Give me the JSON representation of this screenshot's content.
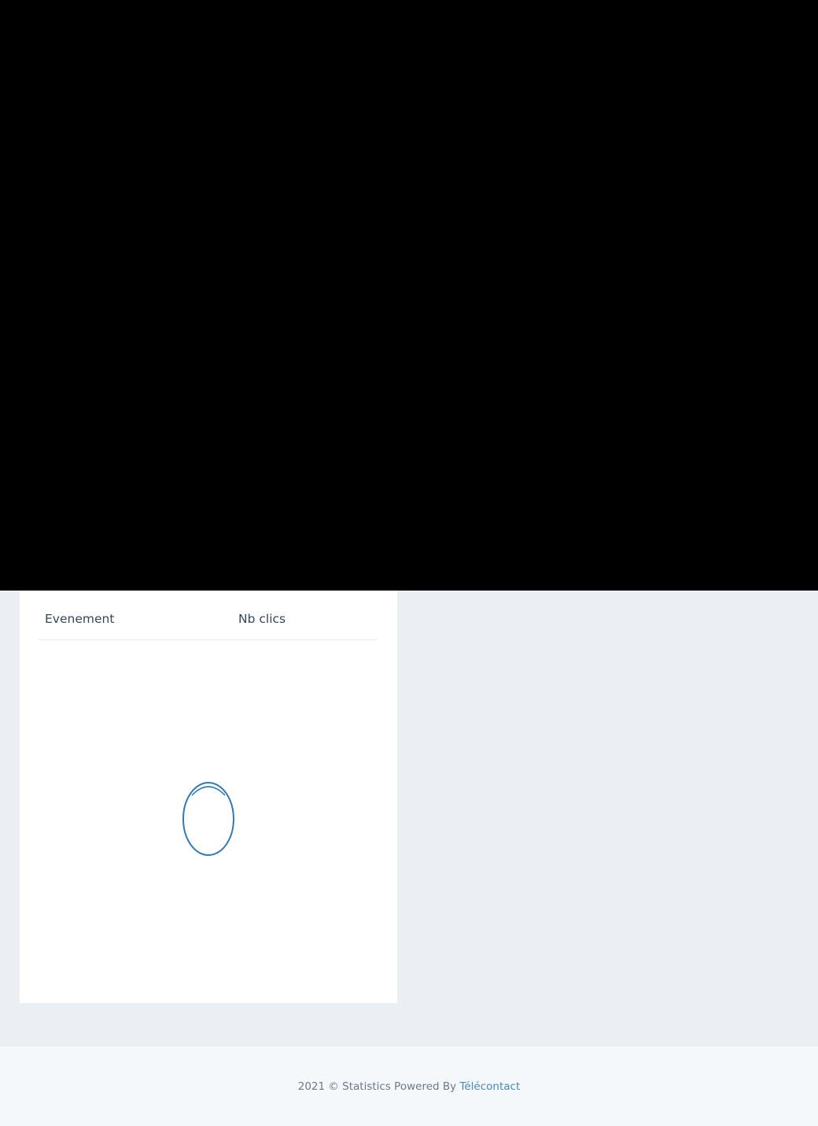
{
  "table": {
    "columns": [
      "Evenement",
      "Nb clics"
    ],
    "rows": []
  },
  "loading": {
    "icon": "loading-spinner-icon",
    "color": "#2f7bb5"
  },
  "footer": {
    "text": "2021 © Statistics Powered By",
    "link_label": "Télécontact"
  },
  "colors": {
    "page_background": "#ebeef2",
    "overlay": "#000000",
    "card_background": "#ffffff",
    "footer_background": "#f5f8fb",
    "link": "#4a88b8"
  }
}
